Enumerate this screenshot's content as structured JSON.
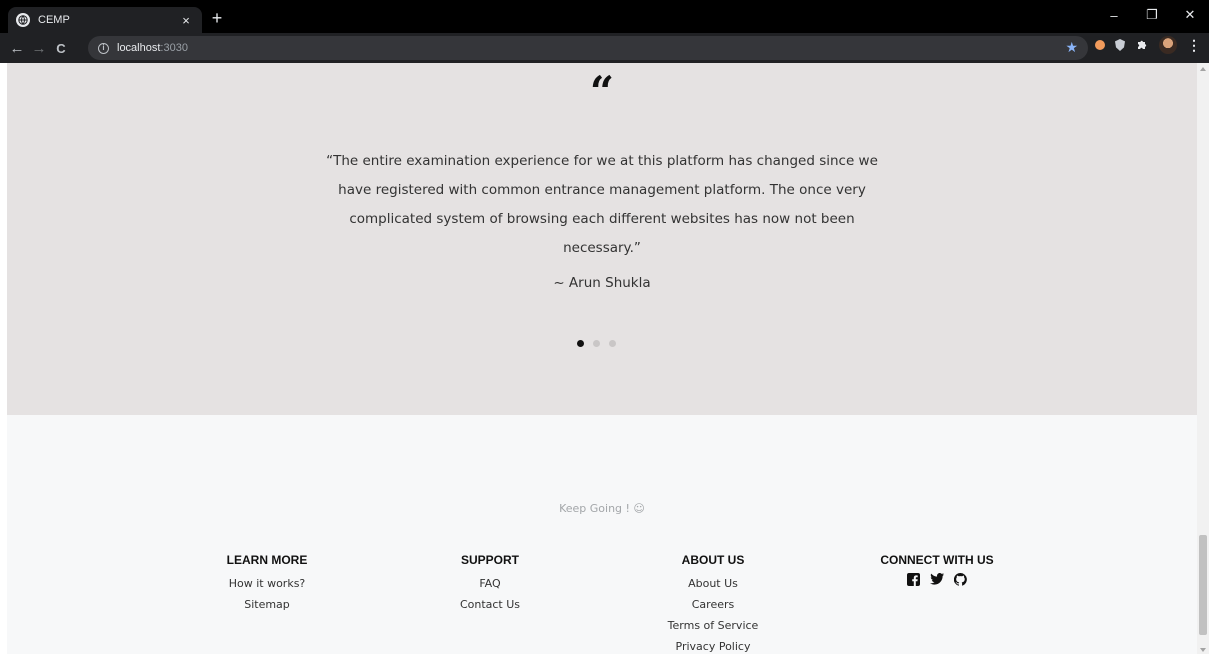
{
  "browser": {
    "tab_title": "CEMP",
    "tab_close": "×",
    "new_tab": "+",
    "url_host": "localhost",
    "url_port": ":3030",
    "window": {
      "minimize": "–",
      "maximize": "❐",
      "close": "✕"
    },
    "nav": {
      "back": "←",
      "forward": "→",
      "reload": "C"
    }
  },
  "testimonial": {
    "quote_mark": "“",
    "text": "“The entire examination experience for we at this platform has changed since we have registered with common entrance management platform. The once very complicated system of browsing each different websites has now not been necessary.”",
    "author": "~ Arun Shukla",
    "dots": [
      {
        "active": true
      },
      {
        "active": false
      },
      {
        "active": false
      }
    ]
  },
  "footer": {
    "tagline": "Keep Going ! ☺",
    "columns": [
      {
        "heading": "LEARN MORE",
        "links": [
          "How it works?",
          "Sitemap"
        ]
      },
      {
        "heading": "SUPPORT",
        "links": [
          "FAQ",
          "Contact Us"
        ]
      },
      {
        "heading": "ABOUT US",
        "links": [
          "About Us",
          "Careers",
          "Terms of Service",
          "Privacy Policy"
        ]
      },
      {
        "heading": "CONNECT WITH US",
        "icons": [
          "facebook-icon",
          "twitter-icon",
          "github-icon"
        ]
      }
    ]
  },
  "colors": {
    "testimonial_bg": "#e5e2e2",
    "footer_bg": "#f7f8f9",
    "chrome_bg": "#202124"
  }
}
